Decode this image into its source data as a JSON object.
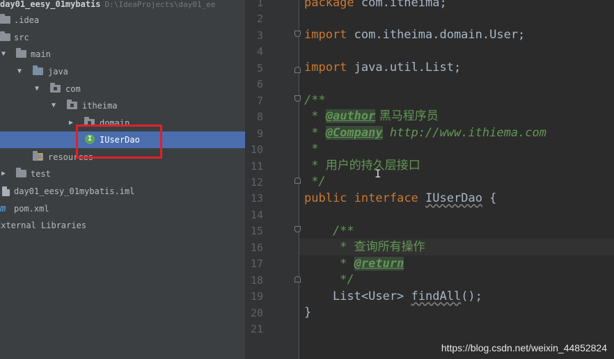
{
  "tree": {
    "rows": [
      {
        "label": "day01_eesy_01mybatis",
        "path": "D:\\IdeaProjects\\day01_ee"
      },
      {
        "label": ".idea"
      },
      {
        "label": "src"
      },
      {
        "label": "main"
      },
      {
        "label": "java"
      },
      {
        "label": "com"
      },
      {
        "label": "itheima"
      },
      {
        "label": "domain"
      },
      {
        "label": "IUserDao",
        "icon_letter": "I"
      },
      {
        "label": "resources"
      },
      {
        "label": "test"
      },
      {
        "label": "day01_eesy_01mybatis.iml"
      },
      {
        "label": "pom.xml",
        "icon_letter": "m"
      },
      {
        "label": "External Libraries"
      }
    ]
  },
  "gutter": {
    "line_numbers": [
      "1",
      "2",
      "3",
      "4",
      "5",
      "6",
      "7",
      "8",
      "9",
      "10",
      "11",
      "12",
      "13",
      "14",
      "15",
      "16",
      "17",
      "18",
      "19",
      "20",
      "21"
    ]
  },
  "code": {
    "l1_kw": "package",
    "l1_rest": " com.itheima;",
    "l3_kw": "import",
    "l3_rest": " com.itheima.domain.User;",
    "l5_kw": "import",
    "l5_rest": " java.util.List;",
    "l7": "/**",
    "l8_star": " * ",
    "l8_tag": "@author",
    "l8_text": " 黑马程序员",
    "l9_star": " * ",
    "l9_tag": "@Company",
    "l9_link": " http://www.ithiema.com",
    "l10": " *",
    "l11_star": " * ",
    "l11_text": "用户的持久层接口",
    "l12": " */",
    "l13_kw1": "public",
    "l13_kw2": "interface",
    "l13_name": "IUserDao",
    "l13_brace": " {",
    "l15": "    /**",
    "l16_star": "     * ",
    "l16_text": "查询所有操作",
    "l17_star": "     * ",
    "l17_tag": "@return",
    "l18": "     */",
    "l19_type": "    List<User> ",
    "l19_method": "findAll",
    "l19_end": "();",
    "l20": "}"
  },
  "watermark": "https://blog.csdn.net/weixin_44852824",
  "colors": {
    "keyword": "#cc7832",
    "doc_comment": "#629755",
    "plain": "#a9b7c6",
    "selection": "#4b6eaf",
    "annotation_box": "#e0202a"
  },
  "icons": [
    "folder-icon",
    "interface-icon",
    "lightbulb-icon",
    "maven-icon",
    "fold-icon"
  ]
}
